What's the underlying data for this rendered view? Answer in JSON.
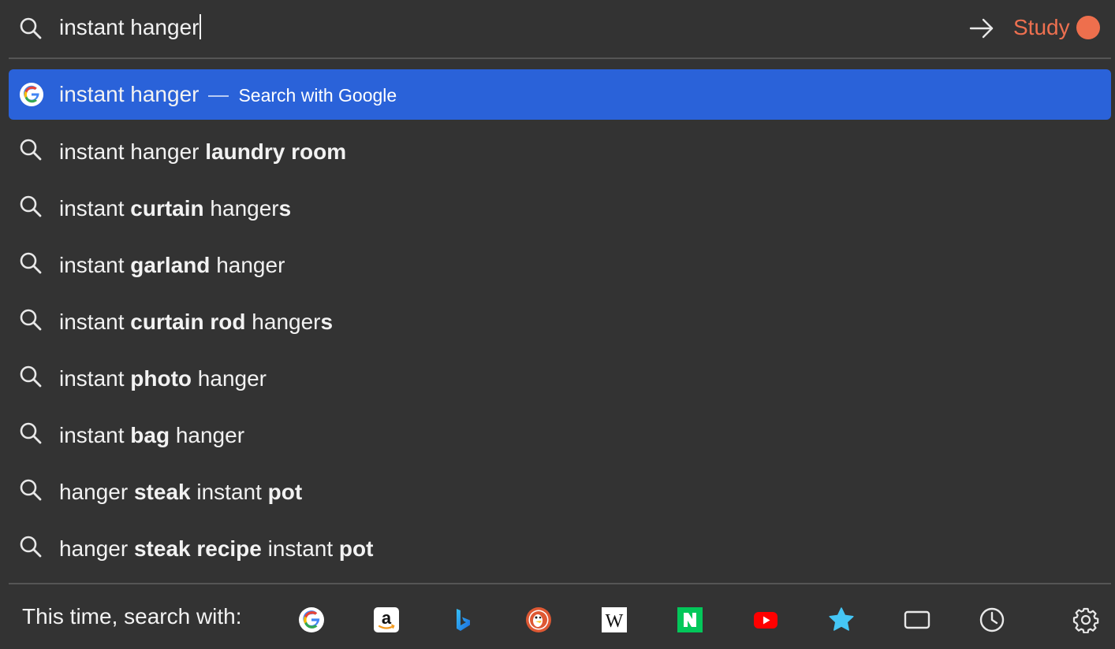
{
  "search": {
    "query": "instant hanger"
  },
  "header": {
    "study_label": "Study",
    "study_color": "#ee6f4d"
  },
  "results": [
    {
      "type": "google",
      "parts": [
        {
          "t": "instant hanger",
          "b": false
        }
      ],
      "hint": "Search with Google",
      "selected": true
    },
    {
      "type": "suggestion",
      "parts": [
        {
          "t": "instant hanger ",
          "b": false
        },
        {
          "t": "laundry room",
          "b": true
        }
      ]
    },
    {
      "type": "suggestion",
      "parts": [
        {
          "t": "instant ",
          "b": false
        },
        {
          "t": "curtain",
          "b": true
        },
        {
          "t": " hanger",
          "b": false
        },
        {
          "t": "s",
          "b": true
        }
      ]
    },
    {
      "type": "suggestion",
      "parts": [
        {
          "t": "instant ",
          "b": false
        },
        {
          "t": "garland",
          "b": true
        },
        {
          "t": " hanger",
          "b": false
        }
      ]
    },
    {
      "type": "suggestion",
      "parts": [
        {
          "t": "instant ",
          "b": false
        },
        {
          "t": "curtain rod",
          "b": true
        },
        {
          "t": " hanger",
          "b": false
        },
        {
          "t": "s",
          "b": true
        }
      ]
    },
    {
      "type": "suggestion",
      "parts": [
        {
          "t": "instant ",
          "b": false
        },
        {
          "t": "photo",
          "b": true
        },
        {
          "t": " hanger",
          "b": false
        }
      ]
    },
    {
      "type": "suggestion",
      "parts": [
        {
          "t": "instant ",
          "b": false
        },
        {
          "t": "bag",
          "b": true
        },
        {
          "t": " hanger",
          "b": false
        }
      ]
    },
    {
      "type": "suggestion",
      "parts": [
        {
          "t": "hanger ",
          "b": false
        },
        {
          "t": "steak",
          "b": true
        },
        {
          "t": " instant ",
          "b": false
        },
        {
          "t": "pot",
          "b": true
        }
      ]
    },
    {
      "type": "suggestion",
      "parts": [
        {
          "t": "hanger ",
          "b": false
        },
        {
          "t": "steak recipe",
          "b": true
        },
        {
          "t": " instant ",
          "b": false
        },
        {
          "t": "pot",
          "b": true
        }
      ]
    }
  ],
  "footer": {
    "label": "This time, search with:",
    "engines": [
      {
        "name": "google-icon"
      },
      {
        "name": "amazon-icon"
      },
      {
        "name": "bing-icon"
      },
      {
        "name": "duckduckgo-icon"
      },
      {
        "name": "wikipedia-icon"
      },
      {
        "name": "naver-icon"
      },
      {
        "name": "youtube-icon"
      },
      {
        "name": "bookmarks-star-icon"
      },
      {
        "name": "tabs-icon"
      },
      {
        "name": "history-clock-icon"
      },
      {
        "name": "settings-gear-icon"
      }
    ]
  },
  "colors": {
    "background": "#333333",
    "selected_row": "#2a62d9",
    "accent": "#ee7050"
  }
}
